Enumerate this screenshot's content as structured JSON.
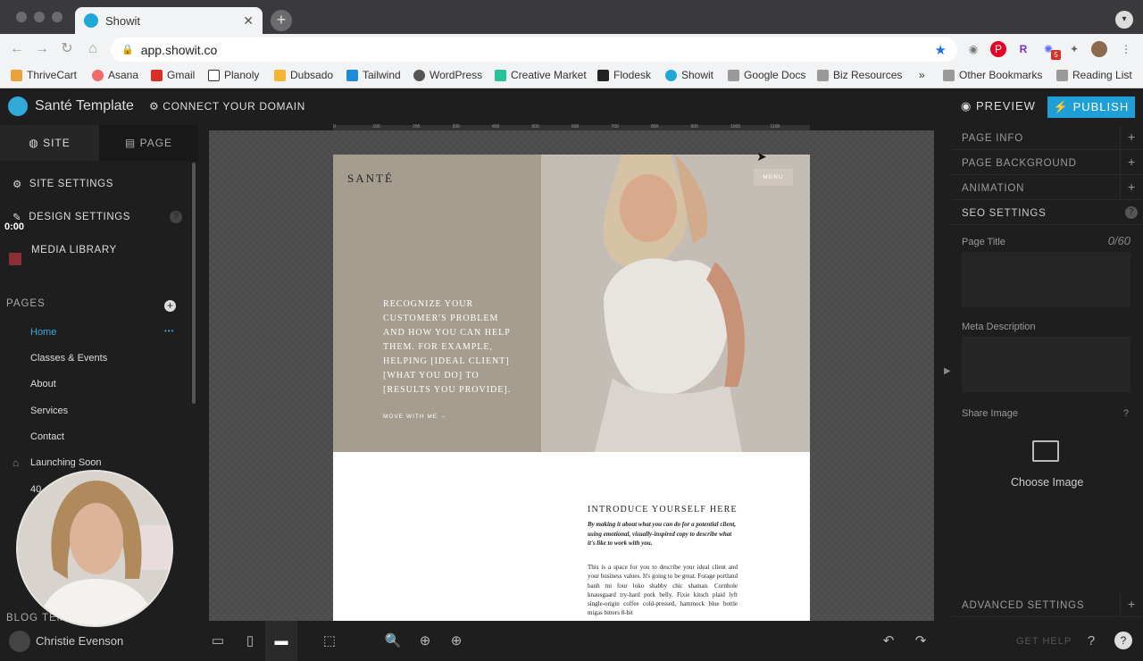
{
  "browser": {
    "tab_title": "Showit",
    "tab_close": "✕",
    "new_tab": "+",
    "url": "app.showit.co",
    "bookmarks": [
      "ThriveCart",
      "Asana",
      "Gmail",
      "Planoly",
      "Dubsado",
      "Tailwind",
      "WordPress",
      "Creative Market",
      "Flodesk",
      "Showit",
      "Google Docs",
      "Biz Resources"
    ],
    "bookmarks_more": "»",
    "other_bookmarks": "Other Bookmarks",
    "reading_list": "Reading List",
    "ext_badge": "5",
    "ext_r": "R"
  },
  "app": {
    "site_name": "Santé Template",
    "connect_domain": "CONNECT YOUR DOMAIN",
    "preview": "PREVIEW",
    "publish": "PUBLISH"
  },
  "left": {
    "tab_site": "SITE",
    "tab_page": "PAGE",
    "site_settings": "SITE SETTINGS",
    "design_settings": "DESIGN SETTINGS",
    "media_library": "MEDIA LIBRARY",
    "timestamp": "0:00",
    "pages_header": "PAGES",
    "pages": [
      "Home",
      "Classes & Events",
      "About",
      "Services",
      "Contact",
      "Launching Soon",
      "40"
    ],
    "more_dots": "•••",
    "blog_header": "BLOG TEM",
    "user_name": "Christie Evenson"
  },
  "canvas": {
    "brand": "SANTÉ",
    "menu": "MENU",
    "hero_copy": "RECOGNIZE YOUR CUSTOMER'S PROBLEM AND HOW YOU CAN HELP THEM. FOR EXAMPLE, HELPING [IDEAL CLIENT] [WHAT YOU DO] TO [RESULTS YOU PROVIDE].",
    "move": "MOVE WITH ME →",
    "intro_title": "INTRODUCE YOURSELF HERE",
    "intro_sub": "By making it about what you can do for a potential client, using emotional, visually-inspired copy to describe what it's like to work with you.",
    "intro_body": "This is a space for you to describe your ideal client and your business values. It's going to be great. Forage portland banh mi four loko shabby chic shaman. Cornhole knausgaard try-hard pork belly. Fixie kitsch plaid lyft single-origin coffee cold-pressed, hammock blue bottle migas bitters 8-bit",
    "ruler_ticks": [
      "0",
      "100",
      "200",
      "300",
      "400",
      "500",
      "600",
      "700",
      "800",
      "900",
      "1000",
      "1100"
    ]
  },
  "right": {
    "page_info": "PAGE INFO",
    "page_background": "PAGE BACKGROUND",
    "animation": "ANIMATION",
    "seo_settings": "SEO SETTINGS",
    "page_title_label": "Page Title",
    "page_title_count": "0/60",
    "meta_description_label": "Meta Description",
    "share_image_label": "Share Image",
    "share_help": "?",
    "choose_image": "Choose Image",
    "advanced_settings": "ADVANCED SETTINGS",
    "plus": "+"
  },
  "bottom": {
    "get_help": "GET HELP"
  },
  "colors": {
    "accent": "#1f9fd8",
    "hero_left": "#a59d8e",
    "active_page": "#3aa8e0"
  }
}
